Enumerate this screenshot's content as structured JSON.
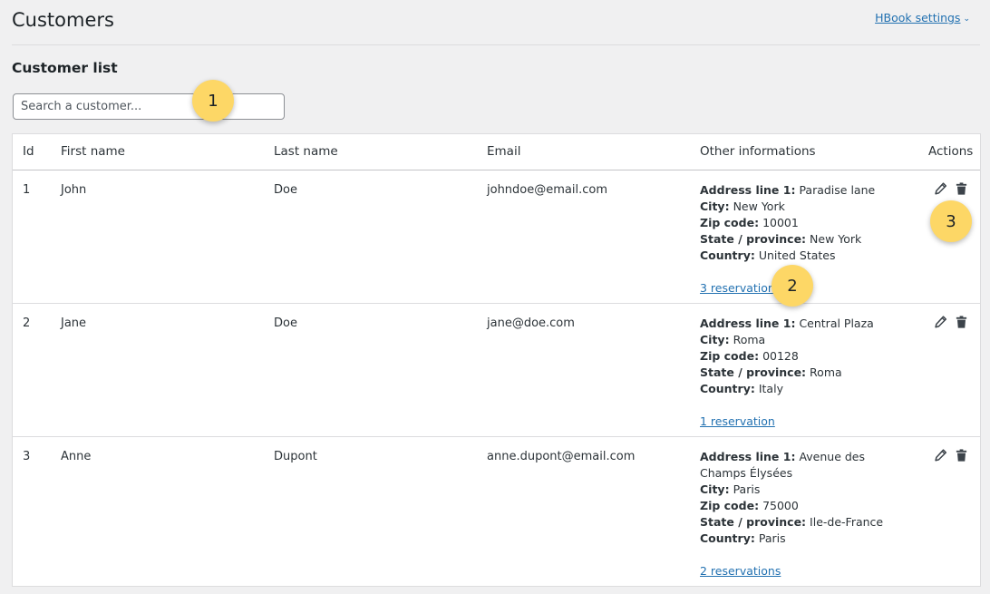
{
  "header": {
    "title": "Customers",
    "settings_link": "HBook settings",
    "settings_chevron": "⌄"
  },
  "section": {
    "title": "Customer list"
  },
  "search": {
    "placeholder": "Search a customer...",
    "value": ""
  },
  "table": {
    "columns": [
      "Id",
      "First name",
      "Last name",
      "Email",
      "Other informations",
      "Actions"
    ],
    "rows": [
      {
        "id": "1",
        "first_name": "John",
        "last_name": "Doe",
        "email": "johndoe@email.com",
        "info": {
          "address_label": "Address line 1:",
          "address": "Paradise lane",
          "city_label": "City:",
          "city": "New York",
          "zip_label": "Zip code:",
          "zip": "10001",
          "state_label": "State / province:",
          "state": "New York",
          "country_label": "Country:",
          "country": "United States"
        },
        "reservations": "3 reservations"
      },
      {
        "id": "2",
        "first_name": "Jane",
        "last_name": "Doe",
        "email": "jane@doe.com",
        "info": {
          "address_label": "Address line 1:",
          "address": "Central Plaza",
          "city_label": "City:",
          "city": "Roma",
          "zip_label": "Zip code:",
          "zip": "00128",
          "state_label": "State / province:",
          "state": "Roma",
          "country_label": "Country:",
          "country": "Italy"
        },
        "reservations": "1 reservation"
      },
      {
        "id": "3",
        "first_name": "Anne",
        "last_name": "Dupont",
        "email": "anne.dupont@email.com",
        "info": {
          "address_label": "Address line 1:",
          "address": "Avenue des Champs Élysées",
          "city_label": "City:",
          "city": "Paris",
          "zip_label": "Zip code:",
          "zip": "75000",
          "state_label": "State / province:",
          "state": "Ile-de-France",
          "country_label": "Country:",
          "country": "Paris"
        },
        "reservations": "2 reservations"
      }
    ],
    "row_actions": [
      {
        "icon": "pencil-icon"
      },
      {
        "icon": "trash-icon"
      }
    ]
  },
  "callouts": [
    "1",
    "2",
    "3"
  ],
  "colors": {
    "background": "#f0f0f1",
    "link": "#2271b1",
    "badge": "#fdd766"
  }
}
